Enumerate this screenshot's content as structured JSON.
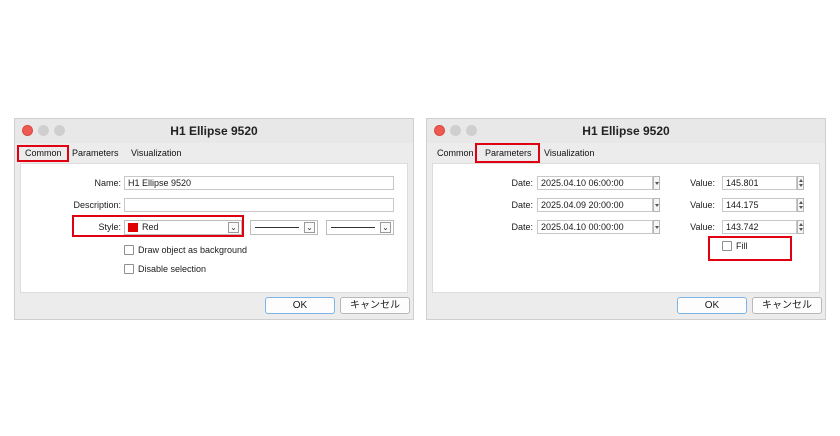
{
  "left_dialog": {
    "title": "H1 Ellipse 9520",
    "tabs": [
      "Common",
      "Parameters",
      "Visualization"
    ],
    "active_tab": "Common",
    "name_label": "Name:",
    "name_value": "H1 Ellipse 9520",
    "description_label": "Description:",
    "description_value": "",
    "style_label": "Style:",
    "style_color_name": "Red",
    "style_color": "#e00000",
    "draw_background_label": "Draw object as background",
    "draw_background_checked": false,
    "disable_selection_label": "Disable selection",
    "disable_selection_checked": false,
    "ok_label": "OK",
    "cancel_label": "キャンセル"
  },
  "right_dialog": {
    "title": "H1 Ellipse 9520",
    "tabs": [
      "Common",
      "Parameters",
      "Visualization"
    ],
    "active_tab": "Parameters",
    "rows": [
      {
        "date_label": "Date:",
        "date_value": "2025.04.10 06:00:00",
        "value_label": "Value:",
        "value": "145.801"
      },
      {
        "date_label": "Date:",
        "date_value": "2025.04.09 20:00:00",
        "value_label": "Value:",
        "value": "144.175"
      },
      {
        "date_label": "Date:",
        "date_value": "2025.04.10 00:00:00",
        "value_label": "Value:",
        "value": "143.742"
      }
    ],
    "fill_label": "Fill",
    "fill_checked": false,
    "ok_label": "OK",
    "cancel_label": "キャンセル"
  },
  "highlight_color": "#e00012"
}
